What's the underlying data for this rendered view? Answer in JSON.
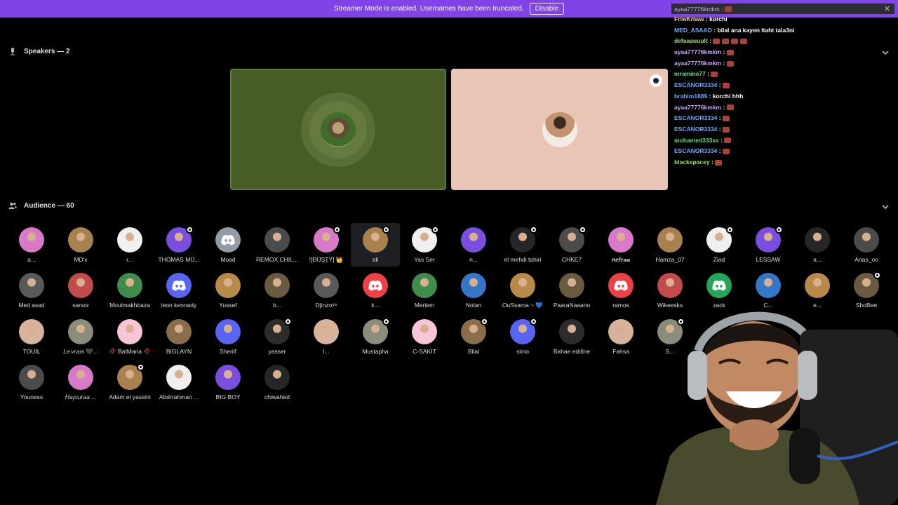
{
  "banner": {
    "text": "Streamer Mode is enabled. Usernames have been truncated.",
    "button": "Disable"
  },
  "speakers": {
    "label": "Speakers — 2"
  },
  "audience": {
    "label": "Audience — 60",
    "rows": [
      [
        "a...",
        "MD'x",
        "r...",
        "THOMAS MÜ...",
        "Moad",
        "REMOX CHIL...",
        "![ĐÜŞŢŸ] 👑",
        "ali",
        "Yas Ser",
        "n...",
        "el mehdi tahiri",
        "CHKE7",
        "𝐧𝐞𝐟𝐫𝐚𝐚",
        "Hamza_07",
        "Ziad",
        "LESSAW",
        "a...",
        "Anas_oo"
      ],
      [
        "Med asad",
        "sarsor",
        "Moulmakhbaza",
        "leon kennady",
        "Yussef",
        "b...",
        "Djinzo⁸⁸",
        "k...",
        "Meriem",
        "Nolan",
        "OuSsama ~ 💙",
        "PaaraNaaano",
        "ramos",
        "Wikeesks",
        "zack",
        "C...",
        "e...",
        "ShoBee"
      ],
      [
        "TOUIL",
        "𝐿𝑒 𝑣𝑟𝑎𝑖𝑠 🖤...",
        "🥀 BatMana 🥀",
        "BIGLAYN",
        "Sheriif",
        "yasser",
        "i...",
        "Mustapha",
        "C-SAKIT",
        "Bilal",
        "simo",
        "Bahae eddine",
        "Fahsa",
        "S...",
        "",
        "",
        "",
        ""
      ],
      [
        "Youness",
        "𝐻𝑎𝑗𝑜𝑢𝑟𝑎𝑎 ...",
        "Adam el yassini",
        "Abdrrahman ...",
        "BIG BOY",
        "chiwahed"
      ]
    ]
  },
  "chat": {
    "top": "ayaa77776kmkm :",
    "lines": [
      {
        "user": "FriwKriww",
        "msg": "korchi",
        "color": "#f5d76e"
      },
      {
        "user": "MED_ASAAD",
        "msg": "bilal ana kayen ltaht tala3ni",
        "color": "#6ea8ff"
      },
      {
        "user": "defaaauuult",
        "msg": "",
        "color": "#9be05b"
      },
      {
        "user": "ayaa77776kmkm",
        "msg": "",
        "color": "#c9a7ff"
      },
      {
        "user": "ayaa77776kmkm",
        "msg": "",
        "color": "#c9a7ff"
      },
      {
        "user": "mramine77",
        "msg": "",
        "color": "#5be07e"
      },
      {
        "user": "ESCANOR3334",
        "msg": "",
        "color": "#6ea8ff"
      },
      {
        "user": "brahim1889",
        "msg": "korchi hhh",
        "color": "#6ea8ff"
      },
      {
        "user": "ayaa77776kmkm",
        "msg": "",
        "color": "#c9a7ff"
      },
      {
        "user": "ESCANOR3334",
        "msg": "",
        "color": "#6ea8ff"
      },
      {
        "user": "ESCANOR3334",
        "msg": "",
        "color": "#6ea8ff"
      },
      {
        "user": "mohamed333xx",
        "msg": "",
        "color": "#5be07e"
      },
      {
        "user": "ESCANOR3334",
        "msg": "",
        "color": "#6ea8ff"
      },
      {
        "user": "blackspacey",
        "msg": "",
        "color": "#9be05b"
      }
    ]
  }
}
